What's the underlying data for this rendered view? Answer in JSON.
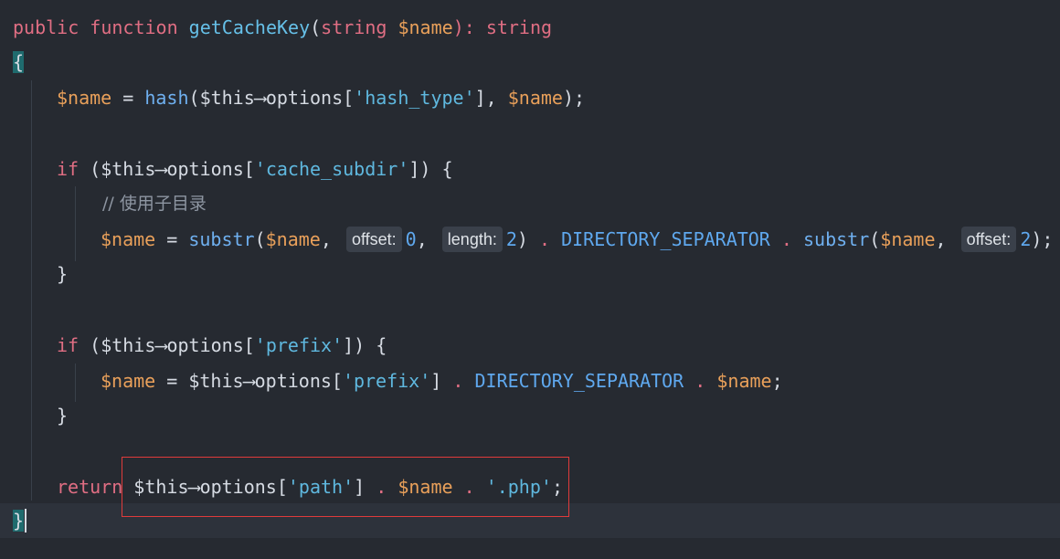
{
  "editor": {
    "lines": {
      "signature": {
        "public": "public",
        "function": "function",
        "name": "getCacheKey",
        "open_paren": "(",
        "type_string": "string",
        "space": " ",
        "param": "$name",
        "close_colon": "): ",
        "return_type": "string"
      },
      "open_brace": "{",
      "hash_line": {
        "var": "$name",
        "eq": " = ",
        "fn": "hash",
        "open": "(",
        "this": "$this",
        "arrow": "⟶",
        "options": "options[",
        "key": "'hash_type'",
        "close": "], ",
        "arg": "$name",
        "end": ");"
      },
      "if_subdir": {
        "kw": "if",
        "open": " (",
        "this": "$this",
        "arrow": "⟶",
        "options": "options[",
        "key": "'cache_subdir'",
        "end": "]) {"
      },
      "comment": "// 使用子目录",
      "substr_line": {
        "var": "$name",
        "eq": " = ",
        "fn1": "substr",
        "open1": "(",
        "arg1": "$name",
        "comma1": ", ",
        "hint_offset1": "offset:",
        "num0": "0",
        "comma2": ", ",
        "hint_length": "length:",
        "num2": "2",
        "close1": ") ",
        "dot1": ".",
        "sep": " DIRECTORY_SEPARATOR ",
        "dot2": ".",
        "space": " ",
        "fn2": "substr",
        "open2": "(",
        "arg2": "$name",
        "comma3": ", ",
        "hint_offset2": "offset:",
        "num2b": "2",
        "end": ");"
      },
      "close_brace_1": "}",
      "if_prefix": {
        "kw": "if",
        "open": " (",
        "this": "$this",
        "arrow": "⟶",
        "options": "options[",
        "key": "'prefix'",
        "end": "]) {"
      },
      "prefix_line": {
        "var": "$name",
        "eq": " = ",
        "this": "$this",
        "arrow": "⟶",
        "options": "options[",
        "key": "'prefix'",
        "close": "] ",
        "dot1": ".",
        "sep": " DIRECTORY_SEPARATOR ",
        "dot2": ".",
        "space": " ",
        "arg": "$name",
        "end": ";"
      },
      "close_brace_2": "}",
      "return_line": {
        "kw": "return",
        "space": " ",
        "this": "$this",
        "arrow": "⟶",
        "options": "options[",
        "key": "'path'",
        "close": "] ",
        "dot1": ".",
        "space2": " ",
        "var": "$name",
        "space3": " ",
        "dot2": ".",
        "space4": " ",
        "ext": "'.php'",
        "end": ";"
      },
      "close_brace_final": "}"
    },
    "colors": {
      "background": "#262a31",
      "keyword": "#e06e83",
      "variable": "#e9a05a",
      "function": "#6fb0f0",
      "string": "#5fb8df",
      "highlight_box": "#e03b3b",
      "brace_match": "#1f6b6e"
    }
  }
}
